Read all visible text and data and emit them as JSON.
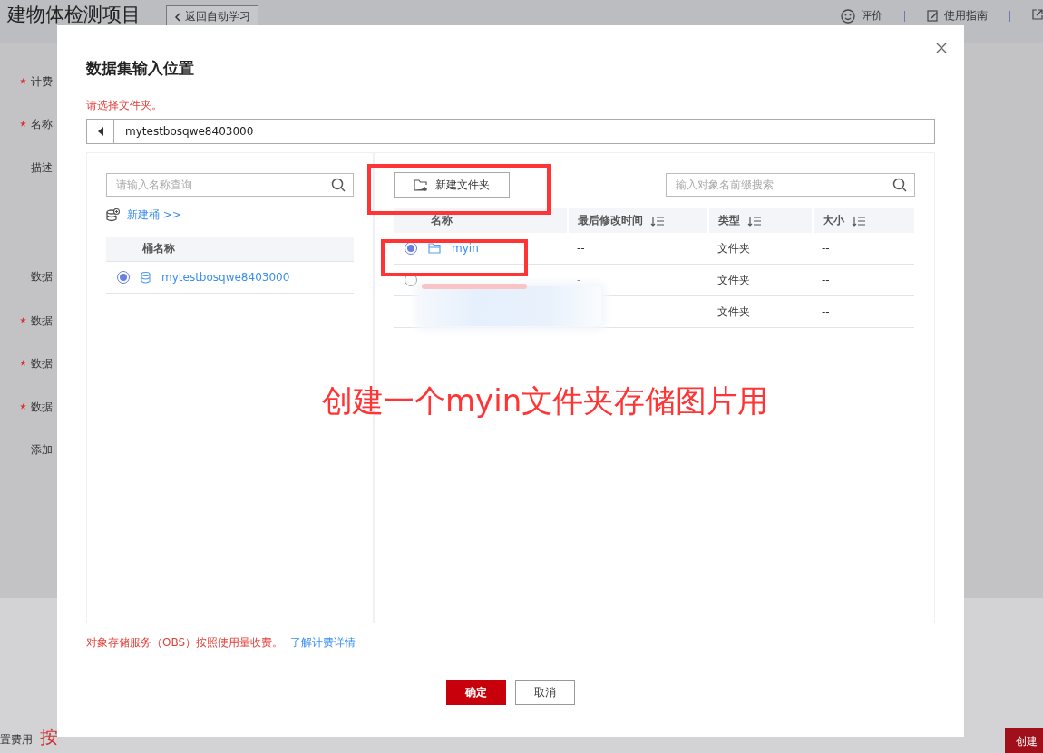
{
  "page": {
    "title": "建物体检测项目",
    "back_button": "返回自动学习",
    "header_links": [
      {
        "label": "评价",
        "kind": "smile"
      },
      {
        "label": "使用指南",
        "kind": "edit"
      }
    ],
    "form_labels": [
      {
        "label": "计费",
        "required": true
      },
      {
        "label": "名称",
        "required": true
      },
      {
        "label": "描述",
        "required": false
      },
      {
        "label": "数据",
        "required": false
      },
      {
        "label": "数据",
        "required": true
      },
      {
        "label": "数据",
        "required": true
      },
      {
        "label": "数据",
        "required": true
      },
      {
        "label": "添加",
        "required": false
      }
    ],
    "fee_label": "置费用",
    "fee_value": "按",
    "create_button": "创建"
  },
  "dialog": {
    "title": "数据集输入位置",
    "error": "请选择文件夹。",
    "path": "mytestbosqwe8403000",
    "bucket_search": {
      "placeholder": "请输入名称查询"
    },
    "new_bucket": "新建桶 >>",
    "bucket_column": "桶名称",
    "buckets": [
      {
        "name": "mytestbosqwe8403000",
        "selected": true
      }
    ],
    "new_folder_button": "新建文件夹",
    "object_search": {
      "placeholder": "输入对象名前缀搜索"
    },
    "columns": [
      {
        "label": "名称",
        "sortable": false
      },
      {
        "label": "最后修改时间",
        "sortable": true
      },
      {
        "label": "类型",
        "sortable": true
      },
      {
        "label": "大小",
        "sortable": true
      }
    ],
    "rows": [
      {
        "name": "myin",
        "modified": "--",
        "type": "文件夹",
        "size": "--",
        "selected": true
      },
      {
        "modified": "-",
        "type": "文件夹",
        "size": "--",
        "selected": false
      },
      {
        "type": "文件夹",
        "size": "--"
      }
    ],
    "footer_note": "对象存储服务（OBS）按照使用量收费。",
    "footer_link": "了解计费详情",
    "confirm": "确定",
    "cancel": "取消"
  },
  "annotation": {
    "text": "创建一个myin文件夹存储图片用"
  }
}
